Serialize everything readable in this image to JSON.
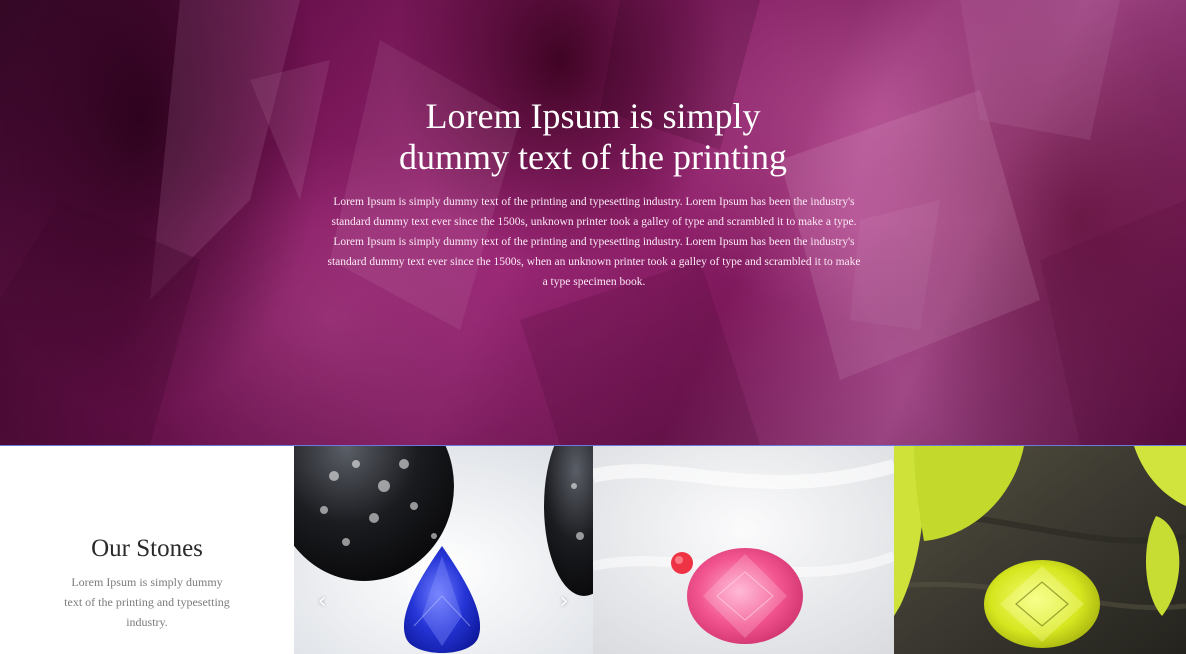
{
  "hero": {
    "title_line1": "Lorem Ipsum is simply",
    "title_line2": "dummy text of the printing",
    "body": "Lorem Ipsum is simply dummy text of the printing and typesetting industry. Lorem Ipsum has been the industry's standard dummy text ever since the 1500s, unknown printer took a galley of type and scrambled it to make a type. Lorem Ipsum is simply dummy text of the printing and typesetting industry. Lorem Ipsum has been the industry's standard dummy text ever since the 1500s, when an unknown printer took a galley of type and scrambled it to make a type specimen book."
  },
  "stones": {
    "title": "Our Stones",
    "description": "Lorem Ipsum is simply dummy text of the printing and typesetting industry.",
    "cards": [
      {
        "stone": "blue pear-cut gemstone"
      },
      {
        "stone": "pink oval gemstone"
      },
      {
        "stone": "yellow-green oval gemstone"
      }
    ],
    "carousel": {
      "prev_icon": "chevron-left-icon",
      "next_icon": "chevron-right-icon",
      "prev_glyph": "‹",
      "next_glyph": "›"
    }
  },
  "colors": {
    "hero_magenta": "#a52a7e",
    "divider": "#6b78e0",
    "heading": "#2a2a2a",
    "muted_text": "#7b7b7b"
  }
}
